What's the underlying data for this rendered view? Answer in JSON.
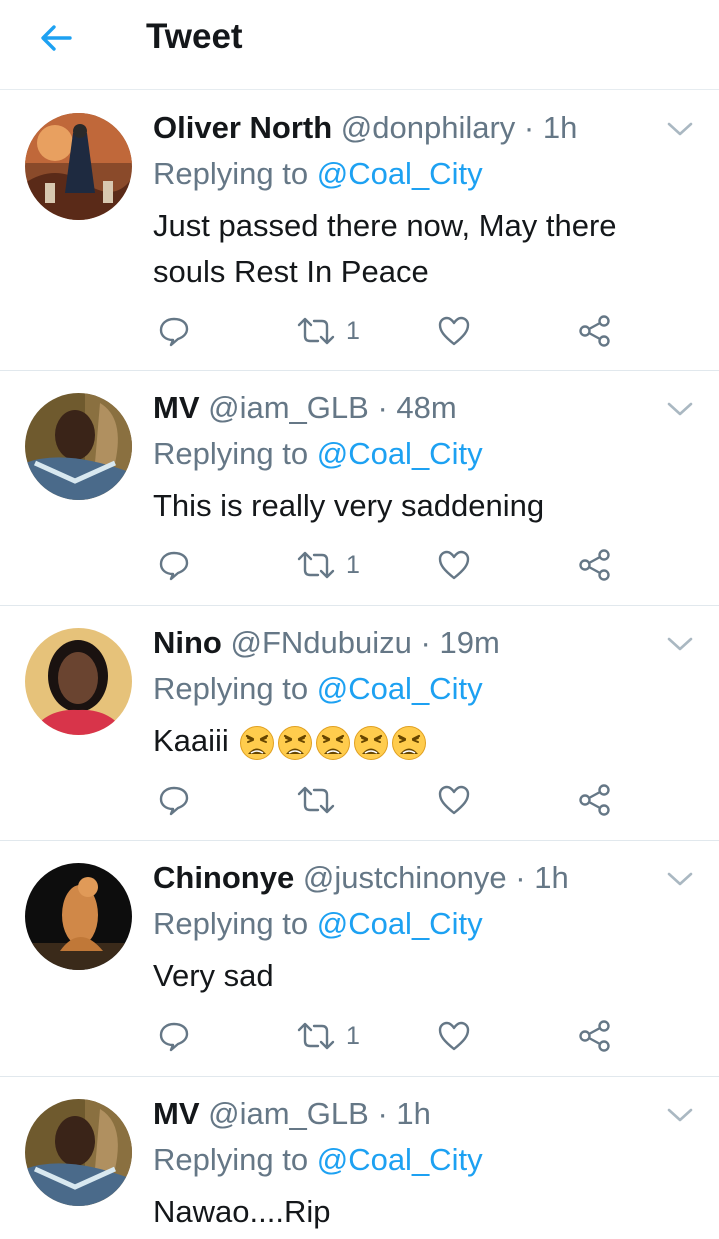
{
  "header": {
    "title": "Tweet",
    "back_icon": "back-arrow-icon"
  },
  "colors": {
    "accent": "#1da1f2",
    "muted": "#657786",
    "text": "#14171a",
    "divider": "#e1e8ed"
  },
  "reply_label": "Replying to",
  "tweets": [
    {
      "name": "Oliver North",
      "handle": "@donphilary",
      "sep": "·",
      "time": "1h",
      "replying_to": "@Coal_City",
      "text": "Just passed there now, May there souls Rest In Peace",
      "retweets": "1",
      "emoji_count": 0
    },
    {
      "name": "MV",
      "handle": "@iam_GLB",
      "sep": "·",
      "time": "48m",
      "replying_to": "@Coal_City",
      "text": "This is really very saddening",
      "retweets": "1",
      "emoji_count": 0
    },
    {
      "name": "Nino",
      "handle": "@FNdubuizu",
      "sep": "·",
      "time": "19m",
      "replying_to": "@Coal_City",
      "text": "Kaaiii",
      "retweets": "",
      "emoji_count": 5,
      "emoji": "weary-face"
    },
    {
      "name": "Chinonye",
      "handle": "@justchinonye",
      "sep": "·",
      "time": "1h",
      "replying_to": "@Coal_City",
      "text": "Very sad",
      "retweets": "1",
      "emoji_count": 0
    },
    {
      "name": "MV",
      "handle": "@iam_GLB",
      "sep": "·",
      "time": "1h",
      "replying_to": "@Coal_City",
      "text": "Nawao....Rip",
      "retweets": "",
      "emoji_count": 0
    }
  ]
}
